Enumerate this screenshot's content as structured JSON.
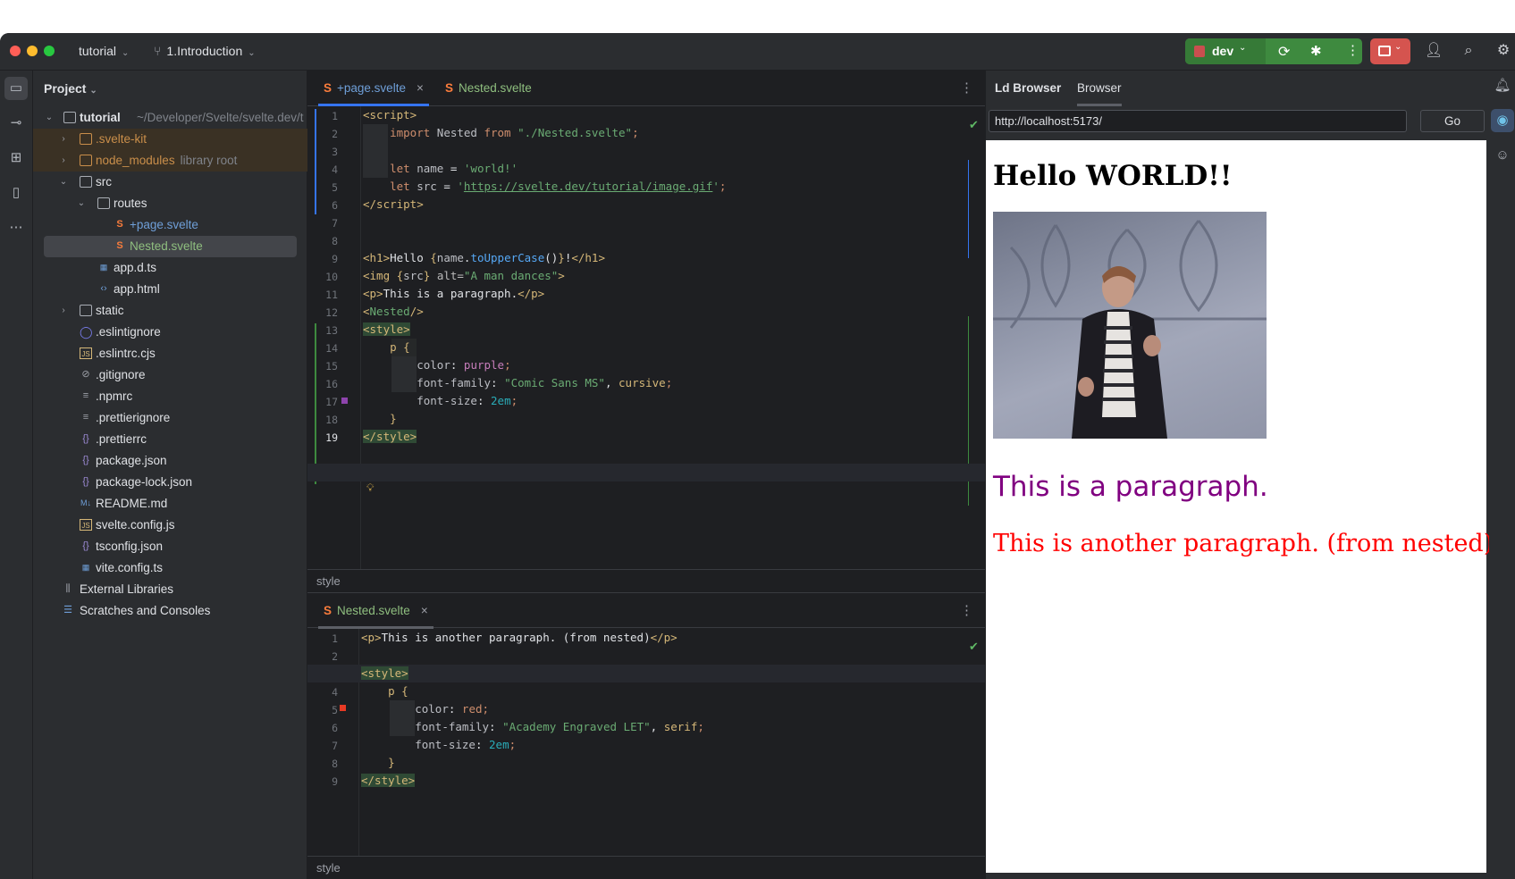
{
  "titlebar": {
    "project": "tutorial",
    "branch": "1.Introduction",
    "run_config": "dev"
  },
  "project_panel": {
    "title": "Project",
    "root": {
      "name": "tutorial",
      "path": "~/Developer/Svelte/svelte.dev/t"
    },
    "items": [
      {
        "label": ".svelte-kit",
        "note": ""
      },
      {
        "label": "node_modules",
        "note": "library root"
      },
      {
        "label": "src",
        "note": ""
      },
      {
        "label": "routes",
        "note": ""
      },
      {
        "label": "+page.svelte",
        "note": ""
      },
      {
        "label": "Nested.svelte",
        "note": ""
      },
      {
        "label": "app.d.ts",
        "note": ""
      },
      {
        "label": "app.html",
        "note": ""
      },
      {
        "label": "static",
        "note": ""
      },
      {
        "label": ".eslintignore",
        "note": ""
      },
      {
        "label": ".eslintrc.cjs",
        "note": ""
      },
      {
        "label": ".gitignore",
        "note": ""
      },
      {
        "label": ".npmrc",
        "note": ""
      },
      {
        "label": ".prettierignore",
        "note": ""
      },
      {
        "label": ".prettierrc",
        "note": ""
      },
      {
        "label": "package.json",
        "note": ""
      },
      {
        "label": "package-lock.json",
        "note": ""
      },
      {
        "label": "README.md",
        "note": ""
      },
      {
        "label": "svelte.config.js",
        "note": ""
      },
      {
        "label": "tsconfig.json",
        "note": ""
      },
      {
        "label": "vite.config.ts",
        "note": ""
      },
      {
        "label": "External Libraries",
        "note": ""
      },
      {
        "label": "Scratches and Consoles",
        "note": ""
      }
    ]
  },
  "editor_top": {
    "tabs": [
      "+page.svelte",
      "Nested.svelte"
    ],
    "breadcrumb": "style",
    "line_numbers": [
      "1",
      "2",
      "3",
      "4",
      "5",
      "6",
      "7",
      "8",
      "9",
      "10",
      "11",
      "12",
      "13",
      "14",
      "15",
      "16",
      "17",
      "18",
      "19"
    ]
  },
  "editor_bottom": {
    "tabs": [
      "Nested.svelte"
    ],
    "breadcrumb": "style",
    "line_numbers": [
      "1",
      "2",
      "3",
      "4",
      "5",
      "6",
      "7",
      "8",
      "9"
    ]
  },
  "browser": {
    "tabs": [
      "Ld Browser",
      "Browser"
    ],
    "url": "http://localhost:5173/",
    "go_label": "Go",
    "heading": "Hello WORLD!!",
    "paragraph1": "This is a paragraph.",
    "paragraph2": "This is another paragraph. (from nested)"
  },
  "colors": {
    "accent": "#3574f0",
    "run_green": "#3e8a3f",
    "stop_red": "#d5544f",
    "svelte_orange": "#f97c3c"
  }
}
